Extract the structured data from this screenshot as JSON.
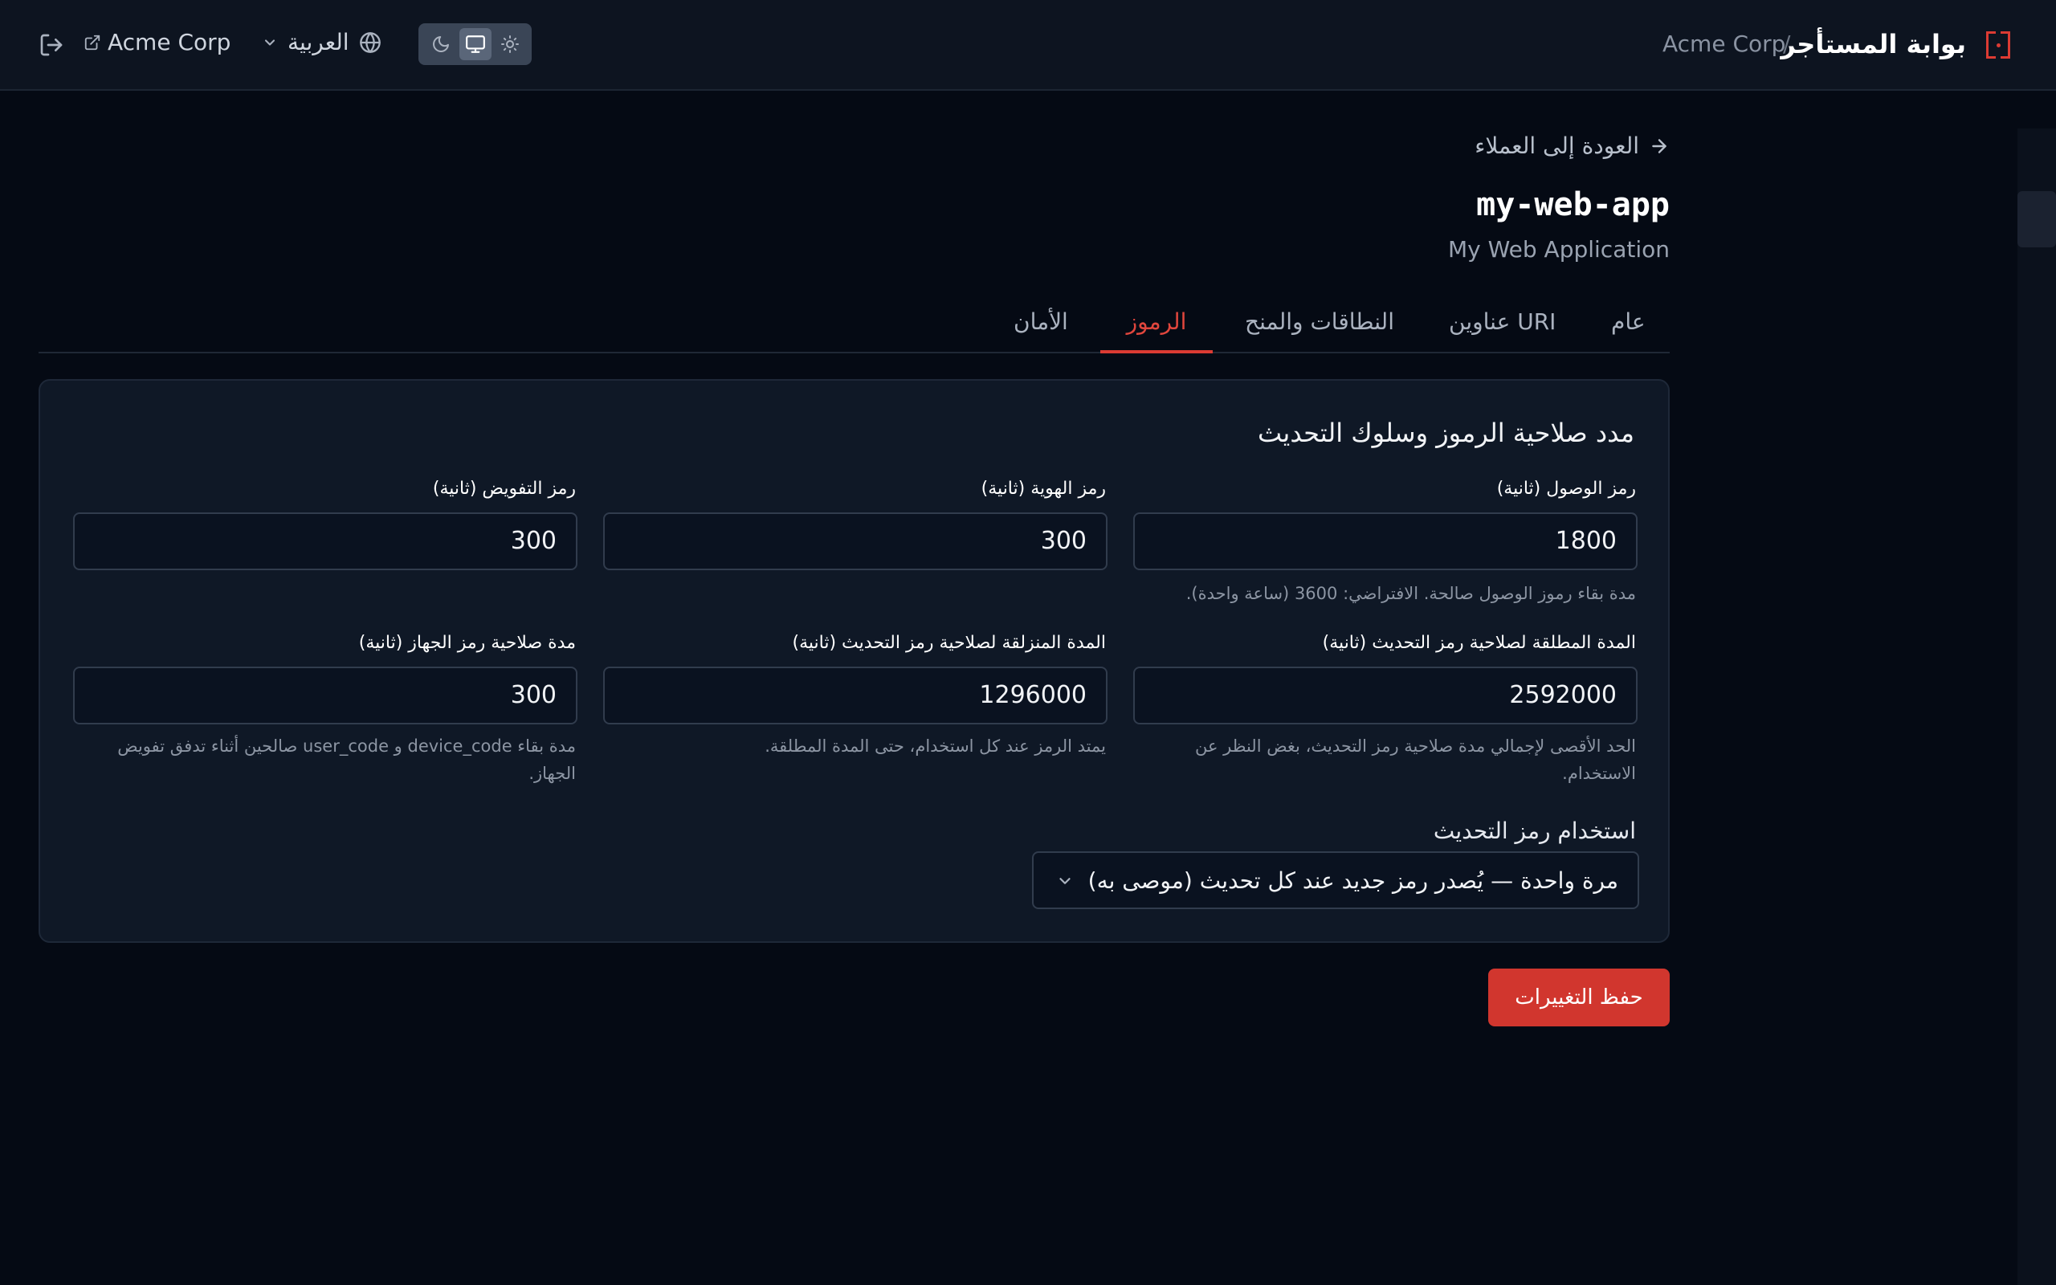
{
  "header": {
    "title": "بوابة المستأجر",
    "separator": "/",
    "tenant": "Acme Corp",
    "tenant_link": "Acme Corp",
    "language": "العربية"
  },
  "client": {
    "back_label": "العودة إلى العملاء",
    "id": "my-web-app",
    "name": "My Web Application"
  },
  "tabs": [
    {
      "label": "عام"
    },
    {
      "label": "عناوين URI"
    },
    {
      "label": "النطاقات والمنح"
    },
    {
      "label": "الرموز",
      "active": true
    },
    {
      "label": "الأمان"
    }
  ],
  "panel": {
    "title": "مدد صلاحية الرموز وسلوك التحديث",
    "fields": [
      {
        "label": "رمز الوصول (ثانية)",
        "value": "1800",
        "help": "مدة بقاء رموز الوصول صالحة. الافتراضي: 3600 (ساعة واحدة)."
      },
      {
        "label": "رمز الهوية (ثانية)",
        "value": "300",
        "help": ""
      },
      {
        "label": "رمز التفويض (ثانية)",
        "value": "300",
        "help": ""
      },
      {
        "label": "المدة المطلقة لصلاحية رمز التحديث (ثانية)",
        "value": "2592000",
        "help": "الحد الأقصى لإجمالي مدة صلاحية رمز التحديث، بغض النظر عن الاستخدام."
      },
      {
        "label": "المدة المنزلقة لصلاحية رمز التحديث (ثانية)",
        "value": "1296000",
        "help": "يمتد الرمز عند كل استخدام، حتى المدة المطلقة."
      },
      {
        "label": "مدة صلاحية رمز الجهاز (ثانية)",
        "value": "300",
        "help": "مدة بقاء device_code و user_code صالحين أثناء تدفق تفويض الجهاز."
      }
    ],
    "refresh_usage_label": "استخدام رمز التحديث",
    "refresh_usage_value": "مرة واحدة — يُصدر رمز جديد عند كل تحديث (موصى به)"
  },
  "save_label": "حفظ التغييرات",
  "colors": {
    "accent": "#dc3b33",
    "background": "#050a14",
    "panel": "#0f1826"
  }
}
